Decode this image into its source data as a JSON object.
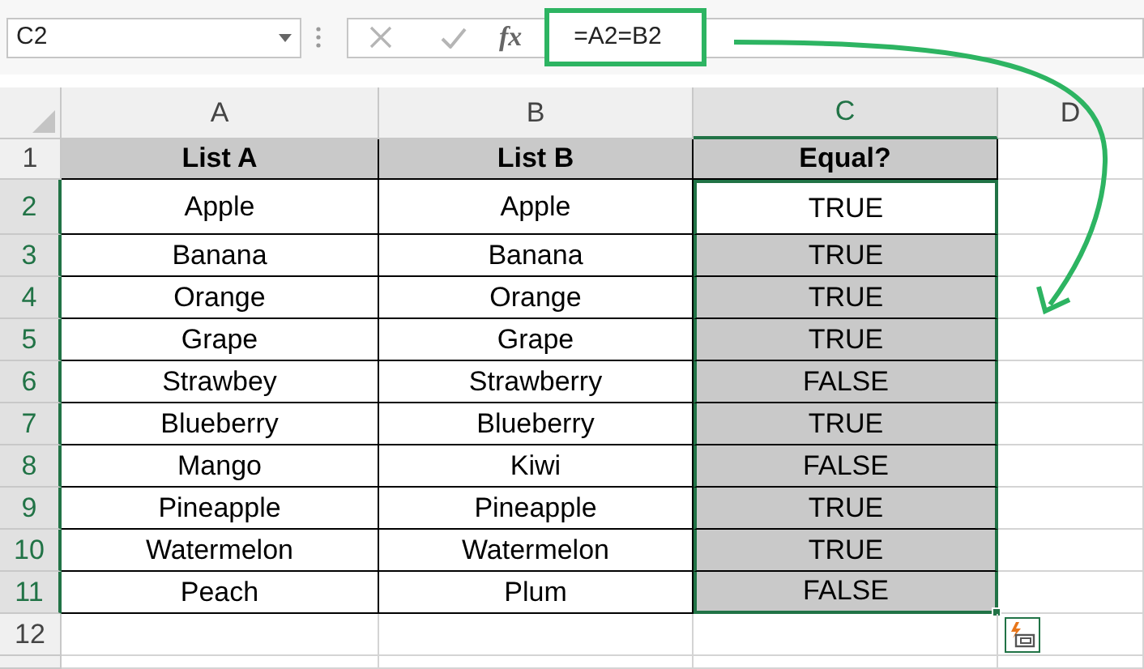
{
  "name_box": "C2",
  "formula_bar": {
    "fx": "fx",
    "formula": "=A2=B2",
    "highlighted": true
  },
  "columns": [
    {
      "label": "A",
      "selected": false
    },
    {
      "label": "B",
      "selected": false
    },
    {
      "label": "C",
      "selected": true
    },
    {
      "label": "D",
      "selected": false
    }
  ],
  "rows": [
    {
      "number": "1",
      "kind": "header",
      "selected": false,
      "cells": [
        {
          "text": "List A",
          "shaded": true
        },
        {
          "text": "List B",
          "shaded": true
        },
        {
          "text": "Equal?",
          "shaded": true
        }
      ]
    },
    {
      "number": "2",
      "kind": "data",
      "selected": true,
      "cells": [
        {
          "text": "Apple",
          "shaded": false
        },
        {
          "text": "Apple",
          "shaded": false
        },
        {
          "text": "TRUE",
          "shaded": false
        }
      ]
    },
    {
      "number": "3",
      "kind": "data",
      "selected": true,
      "cells": [
        {
          "text": "Banana",
          "shaded": false
        },
        {
          "text": "Banana",
          "shaded": false
        },
        {
          "text": "TRUE",
          "shaded": true
        }
      ]
    },
    {
      "number": "4",
      "kind": "data",
      "selected": true,
      "cells": [
        {
          "text": "Orange",
          "shaded": false
        },
        {
          "text": "Orange",
          "shaded": false
        },
        {
          "text": "TRUE",
          "shaded": true
        }
      ]
    },
    {
      "number": "5",
      "kind": "data",
      "selected": true,
      "cells": [
        {
          "text": "Grape",
          "shaded": false
        },
        {
          "text": "Grape",
          "shaded": false
        },
        {
          "text": "TRUE",
          "shaded": true
        }
      ]
    },
    {
      "number": "6",
      "kind": "data",
      "selected": true,
      "cells": [
        {
          "text": "Strawbey",
          "shaded": false
        },
        {
          "text": "Strawberry",
          "shaded": false
        },
        {
          "text": "FALSE",
          "shaded": true
        }
      ]
    },
    {
      "number": "7",
      "kind": "data",
      "selected": true,
      "cells": [
        {
          "text": "Blueberry",
          "shaded": false
        },
        {
          "text": "Blueberry",
          "shaded": false
        },
        {
          "text": "TRUE",
          "shaded": true
        }
      ]
    },
    {
      "number": "8",
      "kind": "data",
      "selected": true,
      "cells": [
        {
          "text": "Mango",
          "shaded": false
        },
        {
          "text": "Kiwi",
          "shaded": false
        },
        {
          "text": "FALSE",
          "shaded": true
        }
      ]
    },
    {
      "number": "9",
      "kind": "data",
      "selected": true,
      "cells": [
        {
          "text": "Pineapple",
          "shaded": false
        },
        {
          "text": "Pineapple",
          "shaded": false
        },
        {
          "text": "TRUE",
          "shaded": true
        }
      ]
    },
    {
      "number": "10",
      "kind": "data",
      "selected": true,
      "cells": [
        {
          "text": "Watermelon",
          "shaded": false
        },
        {
          "text": "Watermelon",
          "shaded": false
        },
        {
          "text": "TRUE",
          "shaded": true
        }
      ]
    },
    {
      "number": "11",
      "kind": "data",
      "selected": true,
      "cells": [
        {
          "text": "Peach",
          "shaded": false
        },
        {
          "text": "Plum",
          "shaded": false
        },
        {
          "text": "FALSE",
          "shaded": true
        }
      ]
    },
    {
      "number": "12",
      "kind": "empty",
      "selected": false,
      "cells": []
    },
    {
      "kind": "empty",
      "cells": []
    }
  ]
}
